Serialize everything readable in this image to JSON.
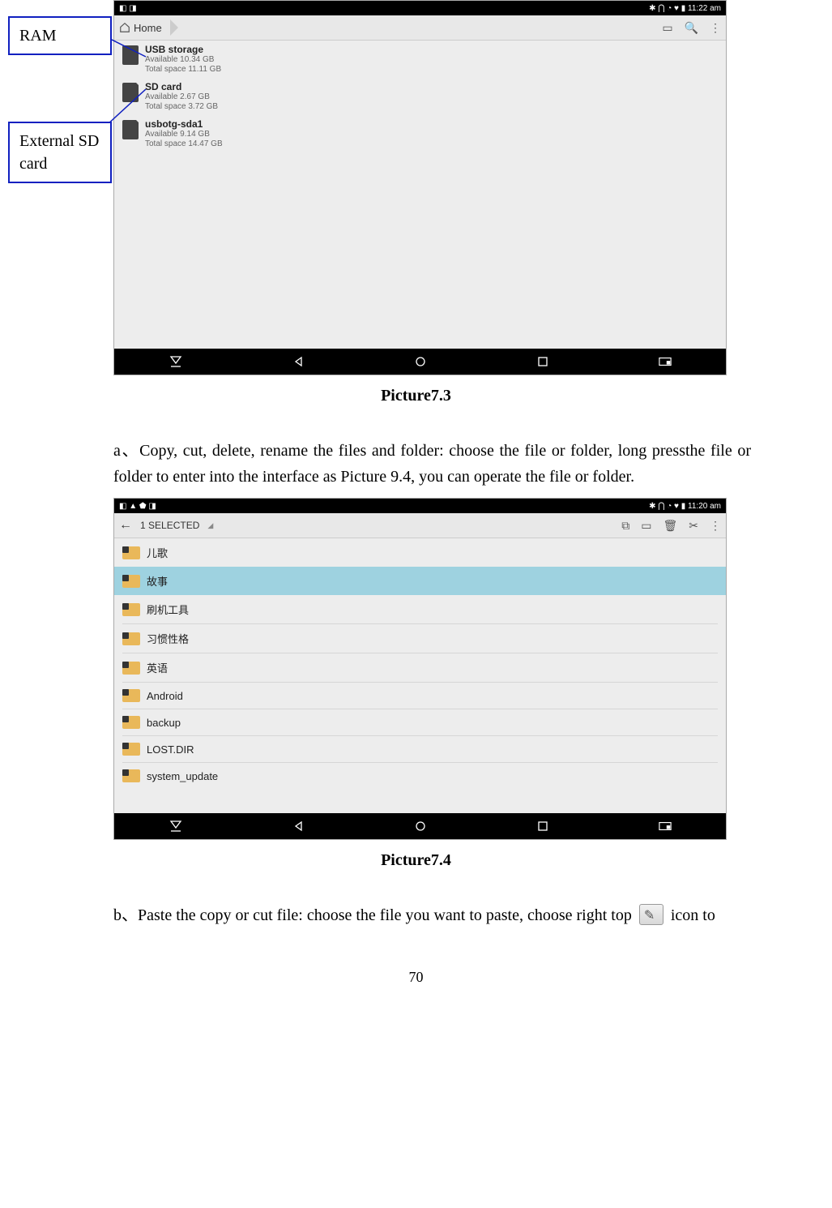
{
  "callouts": {
    "ram": "RAM",
    "sd": "External SD card"
  },
  "screenshot1": {
    "status_left": "◧ ◨",
    "status_right": "✱ ⋂ ◔ ♥ ▮ 11:22 am",
    "breadcrumb_home": "Home",
    "toolbar_icons": {
      "a": "▭",
      "search": "🔍",
      "more": "⋮"
    },
    "storage": [
      {
        "title": "USB storage",
        "available": "Available 10.34 GB",
        "total": "Total space 11.11 GB",
        "kind": "phone"
      },
      {
        "title": "SD card",
        "available": "Available 2.67 GB",
        "total": "Total space 3.72 GB",
        "kind": "sd"
      },
      {
        "title": "usbotg-sda1",
        "available": "Available 9.14 GB",
        "total": "Total space 14.47 GB",
        "kind": "sd"
      }
    ]
  },
  "caption1": "Picture7.3",
  "para_a": "a、Copy, cut, delete, rename the files and folder: choose the file or folder, long pressthe file or folder to enter into the interface as Picture 9.4, you can operate the file or folder.",
  "screenshot2": {
    "status_left": "◧ ▲ ⬟ ◨",
    "status_right": "✱ ⋂ ◔ ♥ ▮ 11:20 am",
    "back": "←",
    "selected_text": "1 SELECTED",
    "toolbar_icons": {
      "copy": "⧉",
      "paste": "▭",
      "delete": "🗑",
      "cut": "✂",
      "more": "⋮"
    },
    "folders": [
      {
        "name": "儿歌",
        "selected": false
      },
      {
        "name": "故事",
        "selected": true
      },
      {
        "name": "刷机工具",
        "selected": false
      },
      {
        "name": "习惯性格",
        "selected": false
      },
      {
        "name": "英语",
        "selected": false
      },
      {
        "name": "Android",
        "selected": false
      },
      {
        "name": "backup",
        "selected": false
      },
      {
        "name": "LOST.DIR",
        "selected": false
      },
      {
        "name": "system_update",
        "selected": false
      }
    ]
  },
  "caption2": "Picture7.4",
  "para_b_pre": "b、Paste the copy or cut file: choose the file you want to paste, choose right top ",
  "para_b_post": " icon to",
  "page_number": "70"
}
